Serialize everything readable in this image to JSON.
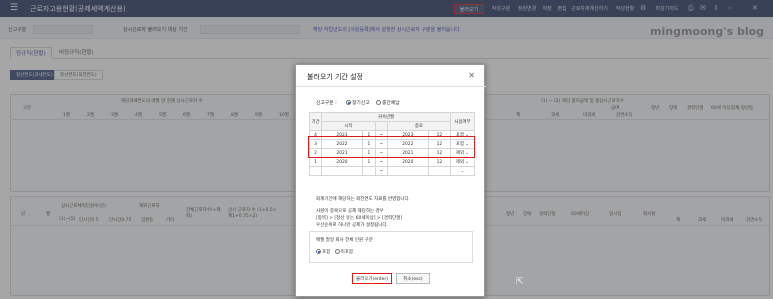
{
  "app": {
    "menu_icon": "hamburger-icon",
    "title": "근로자고용현황(공제세액계산용)",
    "toolbar": [
      "불러오기",
      "작성구분",
      "정원변경",
      "저장",
      "편집",
      "근로자재계산하기",
      "작성현황",
      "마감기이드"
    ],
    "blog_watermark": "mingmoong's blog",
    "accent": "#2f3f66",
    "highlight": "#e01b1b"
  },
  "header": {
    "report_label": "신고구분",
    "period_label": "상시근로자 불러오기 대상 기간",
    "notice": "해당 작업년도의 [사원등록]에서 설정한 상시근로자 구분을 불러옵니다."
  },
  "tabs": [
    "정규직(현황)",
    "비정규직(현황)"
  ],
  "chips": [
    "정산연도(과세연도)",
    "정산연도(직전연도)"
  ],
  "grid_top": {
    "corner": "구분",
    "group_header": "해당과세연도의 매월 말 현재 상시근로자 수",
    "right_group": "(1) ~ (2) 해당 총지급액 및 총상시근로자수",
    "right_sub": "급여",
    "months": [
      "1월",
      "2월",
      "3월",
      "4월",
      "5월",
      "6월",
      "7월",
      "8월",
      "9월",
      "10월"
    ],
    "right_cols": [
      "계",
      "과세",
      "비과세",
      "감면소득",
      "청년",
      "장애",
      "경력단절",
      "60세 이상",
      "합계·청년등"
    ]
  },
  "grid_bottom": {
    "cols": [
      "년",
      "월",
      "상시근로체적인원수(인)",
      "재외근로자",
      "전체근로자수(+제외)",
      "상시 근로자 수 (1+0.5×제1+0.75×2)",
      "청년",
      "장애",
      "경력단절",
      "60세이상",
      "일시업",
      "회사할",
      "계",
      "과세",
      "비과세",
      "감면소득"
    ],
    "sub_cols": [
      "(1)~(5)",
      "단시간0.5",
      "단시간0.75",
      "임원등",
      "기타"
    ]
  },
  "modal": {
    "title": "불러오기 기간 설정",
    "report_label": "신고구분 :",
    "report_options": [
      "정기신고",
      "중간예납"
    ],
    "report_selected": "정기신고",
    "table_headers": {
      "period": "기간",
      "attr_period": "귀속년월",
      "use": "사용여부",
      "start": "시작",
      "end": "종료"
    },
    "rows": [
      {
        "no": "4",
        "start_year": "2023",
        "start_month": "1",
        "dash": "~",
        "end_year": "2023",
        "end_month": "12",
        "use": "포함",
        "selected": true
      },
      {
        "no": "3",
        "start_year": "2022",
        "start_month": "1",
        "dash": "~",
        "end_year": "2022",
        "end_month": "12",
        "use": "포함",
        "selected": true
      },
      {
        "no": "2",
        "start_year": "2021",
        "start_month": "1",
        "dash": "~",
        "end_year": "2021",
        "end_month": "12",
        "use": "제외",
        "selected": false
      },
      {
        "no": "1",
        "start_year": "2020",
        "start_month": "1",
        "dash": "~",
        "end_year": "2020",
        "end_month": "12",
        "use": "제외",
        "selected": false
      },
      {
        "no": "",
        "start_year": "",
        "start_month": "",
        "dash": "~",
        "end_year": "",
        "end_month": "",
        "use": "",
        "selected": false
      }
    ],
    "notes": [
      "회계기간에 해당하는 회전연도 자료를 반영합니다.",
      "사원이 중복으로 공제 해당하는 경우",
      "[항목] > [정산 유는 60세이상] > [경력단절]",
      "우선순위로 하나만 공제가 설정됩니다."
    ],
    "sub_label": "매월 말일 회사 전체 인원 구분",
    "sub_options": [
      "포함",
      "미포함"
    ],
    "sub_selected": "포함",
    "ok_label": "불러오기(enter)",
    "cancel_label": "취소(esc)"
  }
}
